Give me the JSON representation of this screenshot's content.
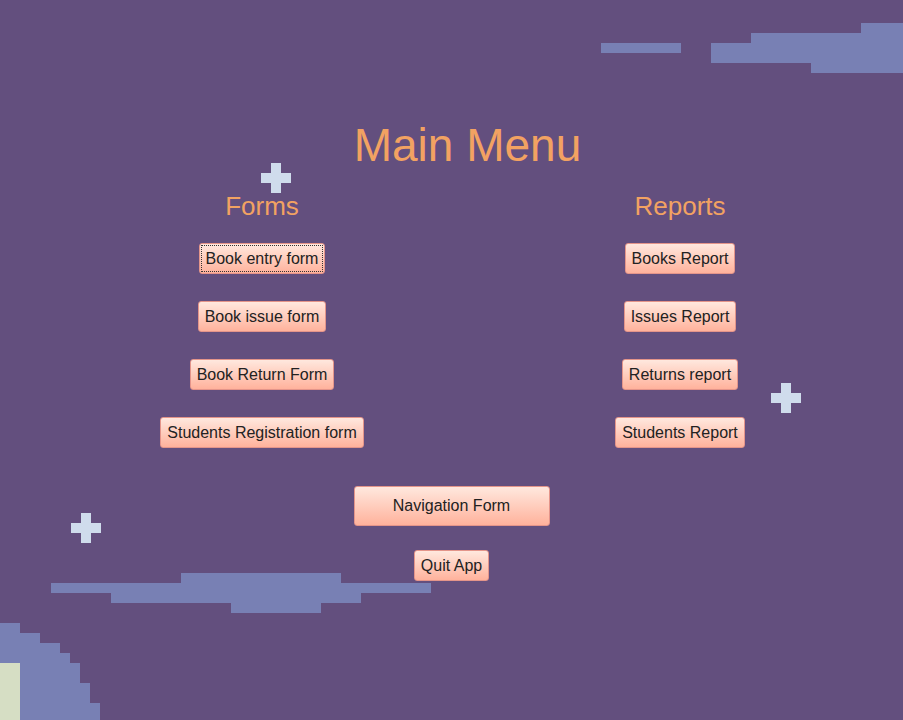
{
  "window": {
    "title": "Main Menu"
  },
  "sections": [
    {
      "heading": "Forms",
      "buttons": [
        {
          "label": "Book entry form",
          "focused": true
        },
        {
          "label": "Book issue form",
          "focused": false
        },
        {
          "label": "Book Return Form",
          "focused": false
        },
        {
          "label": "Students Registration form",
          "focused": false
        }
      ]
    },
    {
      "heading": "Reports",
      "buttons": [
        {
          "label": "Books Report",
          "focused": false
        },
        {
          "label": "Issues Report",
          "focused": false
        },
        {
          "label": "Returns report",
          "focused": false
        },
        {
          "label": "Students Report",
          "focused": false
        }
      ]
    }
  ],
  "bottom_buttons": [
    {
      "label": "Navigation Form",
      "focused": false,
      "kind": "large"
    },
    {
      "label": "Quit App",
      "focused": false,
      "kind": "small"
    }
  ]
}
